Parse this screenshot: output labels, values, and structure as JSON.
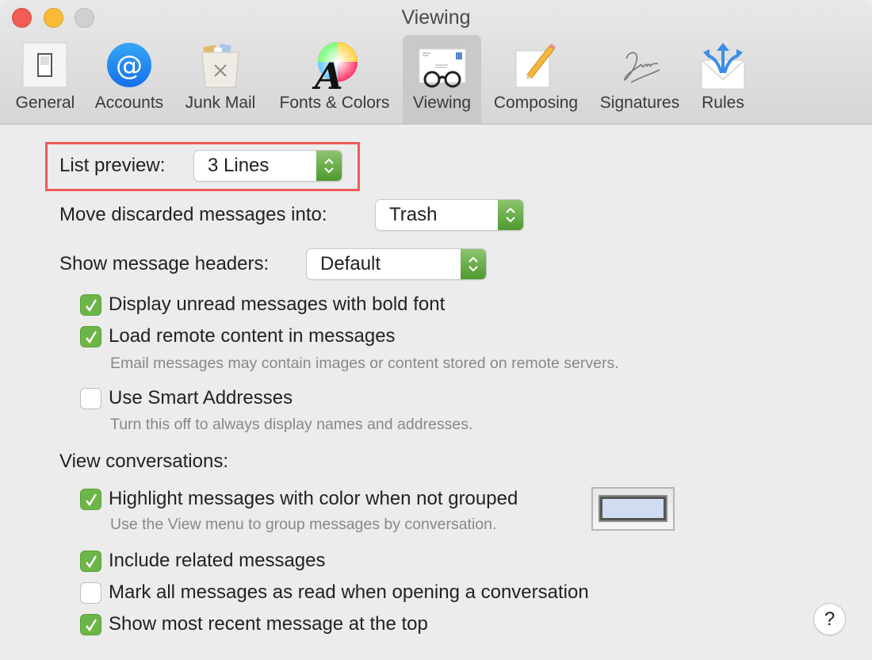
{
  "window": {
    "title": "Viewing",
    "traffic_lights": [
      "close",
      "minimize",
      "zoom"
    ]
  },
  "toolbar": {
    "tabs": [
      {
        "label": "General",
        "icon": "switch-icon",
        "selected": false
      },
      {
        "label": "Accounts",
        "icon": "at-sign-icon",
        "selected": false
      },
      {
        "label": "Junk Mail",
        "icon": "junk-bin-icon",
        "selected": false
      },
      {
        "label": "Fonts & Colors",
        "icon": "color-wheel-font-icon",
        "selected": false
      },
      {
        "label": "Viewing",
        "icon": "glasses-letter-icon",
        "selected": true
      },
      {
        "label": "Composing",
        "icon": "pencil-paper-icon",
        "selected": false
      },
      {
        "label": "Signatures",
        "icon": "signature-icon",
        "selected": false
      },
      {
        "label": "Rules",
        "icon": "envelope-arrows-icon",
        "selected": false
      }
    ]
  },
  "settings": {
    "list_preview": {
      "label": "List preview:",
      "value": "3 Lines"
    },
    "move_discarded": {
      "label": "Move discarded messages into:",
      "value": "Trash"
    },
    "message_headers": {
      "label": "Show message headers:",
      "value": "Default"
    },
    "checkboxes": [
      {
        "label": "Display unread messages with bold font",
        "checked": true
      },
      {
        "label": "Load remote content in messages",
        "checked": true,
        "note": "Email messages may contain images or content stored on remote servers."
      },
      {
        "label": "Use Smart Addresses",
        "checked": false,
        "note": "Turn this off to always display names and addresses."
      }
    ],
    "view_conversations": {
      "label": "View conversations:",
      "options": [
        {
          "label": "Highlight messages with color when not grouped",
          "checked": true,
          "note": "Use the View menu to group messages by conversation."
        },
        {
          "label": "Include related messages",
          "checked": true
        },
        {
          "label": "Mark all messages as read when opening a conversation",
          "checked": false
        },
        {
          "label": "Show most recent message at the top",
          "checked": true
        }
      ],
      "highlight_color": "#cfdcf1"
    }
  },
  "help": {
    "label": "?"
  },
  "colors": {
    "accent_green": "#6cb547",
    "annotation_red": "#ee5b57"
  }
}
